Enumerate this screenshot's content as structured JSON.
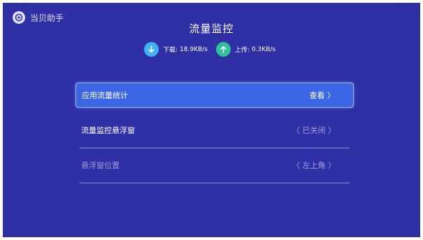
{
  "brand": {
    "name": "当贝助手",
    "icon": "dangbei-logo-icon"
  },
  "page": {
    "title": "流量监控"
  },
  "stats": {
    "download": {
      "label": "下载:",
      "value": "18.9KB/s",
      "icon": "arrow-down-icon",
      "color": "#3fb4f0"
    },
    "upload": {
      "label": "上传:",
      "value": "0.3KB/s",
      "icon": "arrow-up-icon",
      "color": "#2fc39a"
    }
  },
  "menu": {
    "items": [
      {
        "label": "应用流量统计",
        "value": "查看 〉",
        "state": "focused"
      },
      {
        "label": "流量监控悬浮窗",
        "value": "〈 已关闭 〉",
        "state": "normal"
      },
      {
        "label": "悬浮窗位置",
        "value": "〈 左上角 〉",
        "state": "disabled"
      }
    ]
  },
  "colors": {
    "background": "#2f2fa6",
    "focus": "#3b66e6"
  }
}
